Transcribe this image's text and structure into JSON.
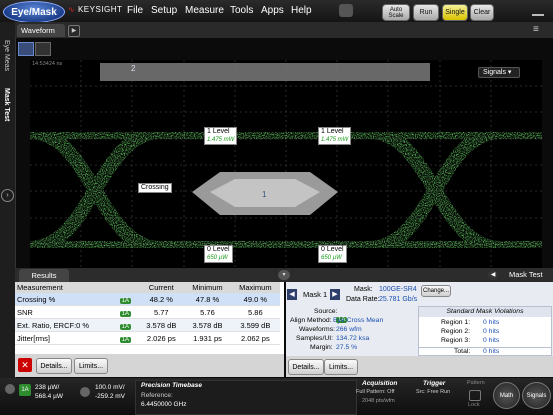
{
  "topbar": {
    "mode_button": "Eye/Mask",
    "brand": "KEYSIGHT",
    "menus": [
      "File",
      "Setup",
      "Measure",
      "Tools",
      "Apps",
      "Help"
    ],
    "autoscale_label": "Auto Scale",
    "run_label": "Run",
    "single_label": "Single",
    "clear_label": "Clear"
  },
  "left_tabs": [
    "Eye Meas",
    "Mask Test"
  ],
  "waveform": {
    "tab_label": "Waveform",
    "timestamp": "14:53424 ns",
    "signals_label": "Signals",
    "mask_region_2": "2",
    "mask_region_1": "1",
    "markers": {
      "level1_left": {
        "title": "1 Level",
        "value": "1.475 mW"
      },
      "level1_right": {
        "title": "1 Level",
        "value": "1.475 mW"
      },
      "crossing": {
        "title": "Crossing"
      },
      "level0_left": {
        "title": "0 Level",
        "value": "650 µW"
      },
      "level0_right": {
        "title": "0 Level",
        "value": "650 µW"
      }
    }
  },
  "results": {
    "tab_label": "Results",
    "mask_test_label": "Mask Test",
    "columns": [
      "Measurement",
      "Current",
      "Minimum",
      "Maximum"
    ],
    "rows": [
      {
        "name": "Crossing %",
        "src": "1A",
        "current": "48.2 %",
        "min": "47.8 %",
        "max": "49.0 %"
      },
      {
        "name": "SNR",
        "src": "1A",
        "current": "5.77",
        "min": "5.76",
        "max": "5.86"
      },
      {
        "name": "Ext. Ratio, ERCF:0 %",
        "src": "1A",
        "current": "3.578 dB",
        "min": "3.578 dB",
        "max": "3.599 dB"
      },
      {
        "name": "Jitter[rms]",
        "src": "1A",
        "current": "2.026 ps",
        "min": "1.931 ps",
        "max": "2.062 ps"
      }
    ],
    "details_label": "Details...",
    "limits_label": "Limits..."
  },
  "mask": {
    "title": "Mask 1",
    "mask_label": "Mask:",
    "mask_value": "100GE-SR4",
    "change_label": "Change...",
    "data_rate_label": "Data Rate:",
    "data_rate_value": "25.781 Gb/s",
    "source_label": "Source:",
    "source_value": "1A",
    "align_label": "Align Method:",
    "align_value": "Eye Cross Mean",
    "waveforms_label": "Waveforms:",
    "waveforms_value": "266 wfm",
    "samples_label": "Samples/UI:",
    "samples_value": "134.72 ksa",
    "margin_label": "Margin:",
    "margin_value": "27.5 %",
    "violations_title": "Standard Mask Violations",
    "regions": [
      {
        "label": "Region 1:",
        "value": "0 hits"
      },
      {
        "label": "Region 2:",
        "value": "0 hits"
      },
      {
        "label": "Region 3:",
        "value": "0 hits"
      },
      {
        "label": "Total:",
        "value": "0 hits"
      }
    ],
    "details_label": "Details...",
    "limits_label": "Limits..."
  },
  "bottom": {
    "ch1_line1": "238 µW/",
    "ch1_line2": "568.4 µW",
    "ch2_line1": "100.0 mV/",
    "ch2_line2": "-259.2 mV",
    "timebase_title": "Precision Timebase",
    "timebase_ref_label": "Reference:",
    "timebase_ref_value": "6.4450000 GHz",
    "acq_title": "Acquisition",
    "acq_line1": "Full Pattern: Off",
    "acq_line2": "2048 pts/wfm",
    "trigger_title": "Trigger",
    "trigger_line1": "Src: Free Run",
    "pattern_label": "Pattern",
    "lock_label": "Lock",
    "math_label": "Math",
    "signals_label": "Signals"
  },
  "colors": {
    "accent": "#1d3e8a",
    "trace": "#2fd12f",
    "mask": "#9a9a9a"
  }
}
